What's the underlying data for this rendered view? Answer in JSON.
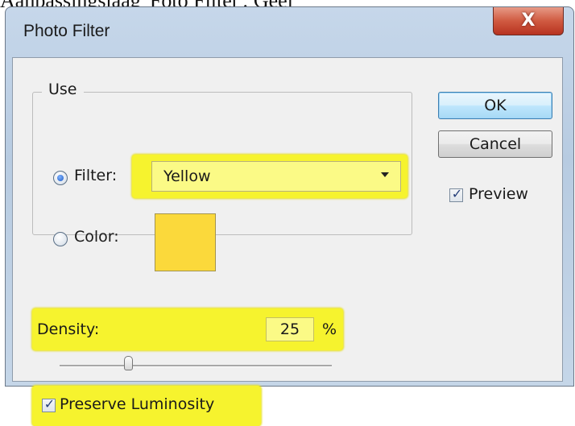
{
  "caption": "Aanpassingslaag 'Foto Filter': Geel",
  "dialog": {
    "title": "Photo Filter",
    "close_glyph": "X"
  },
  "use_group": {
    "legend": "Use",
    "filter_label": "Filter:",
    "filter_selected": true,
    "filter_value": "Yellow",
    "color_label": "Color:",
    "color_selected": false,
    "color_swatch": "#fbd93b"
  },
  "buttons": {
    "ok": "OK",
    "cancel": "Cancel"
  },
  "preview": {
    "label": "Preview",
    "checked": true
  },
  "density": {
    "label": "Density:",
    "value": "25",
    "unit": "%",
    "slider_percent": 25
  },
  "preserve_luminosity": {
    "label": "Preserve Luminosity",
    "checked": true
  },
  "colors": {
    "highlight": "#f6f32e",
    "title_gradient": "#c6d7ea",
    "close_button": "#d05a41"
  },
  "icons": {
    "close": "close-icon",
    "dropdown": "chevron-down-icon",
    "check": "check-icon"
  }
}
